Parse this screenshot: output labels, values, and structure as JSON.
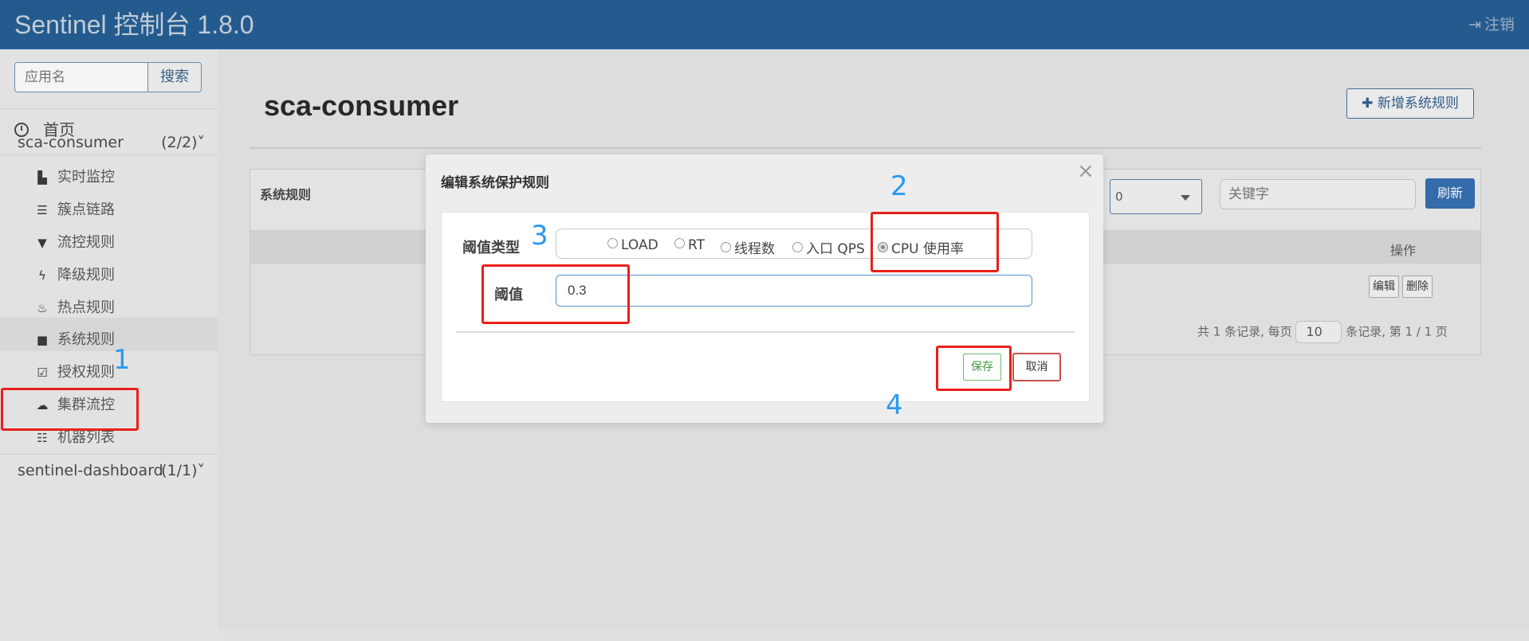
{
  "header": {
    "brand": "Sentinel 控制台 1.8.0",
    "logout_label": "注销"
  },
  "sidebar": {
    "search_placeholder": "应用名",
    "search_button": "搜索",
    "home_label": "首页",
    "apps": [
      {
        "name": "sca-consumer",
        "count": "(2/2)"
      },
      {
        "name": "sentinel-dashboard",
        "count": "(1/1)"
      }
    ],
    "menu": [
      {
        "label": "实时监控",
        "icon": "bar-chart-icon"
      },
      {
        "label": "簇点链路",
        "icon": "list-icon"
      },
      {
        "label": "流控规则",
        "icon": "filter-icon"
      },
      {
        "label": "降级规则",
        "icon": "flash-icon"
      },
      {
        "label": "热点规则",
        "icon": "fire-icon"
      },
      {
        "label": "系统规则",
        "icon": "lock-icon"
      },
      {
        "label": "授权规则",
        "icon": "check-square-icon"
      },
      {
        "label": "集群流控",
        "icon": "cloud-icon"
      },
      {
        "label": "机器列表",
        "icon": "th-list-icon"
      }
    ]
  },
  "main": {
    "page_title": "sca-consumer",
    "add_button": "新增系统规则",
    "panel_title": "系统规则",
    "select_value": "0",
    "keyword_placeholder": "关键字",
    "refresh_button": "刷新",
    "column_ops": "操作",
    "edit_button": "编辑",
    "delete_button": "删除",
    "pager": {
      "prefix": "共 1 条记录, 每页",
      "page_size": "10",
      "suffix": "条记录, 第 1 / 1 页"
    }
  },
  "modal": {
    "title": "编辑系统保护规则",
    "close": "×",
    "type_label": "阈值类型",
    "types": [
      "LOAD",
      "RT",
      "线程数",
      "入口 QPS",
      "CPU 使用率"
    ],
    "selected_type": "CPU 使用率",
    "threshold_label": "阈值",
    "threshold_value": "0.3",
    "save_button": "保存",
    "cancel_button": "取消"
  },
  "annotations": {
    "n1": "1",
    "n2": "2",
    "n3": "3",
    "n4": "4"
  },
  "colors": {
    "header": "#1e5a92",
    "annotation_box": "#e8201c",
    "annotation_number": "#2a9af0",
    "primary": "#2e6bb0"
  }
}
